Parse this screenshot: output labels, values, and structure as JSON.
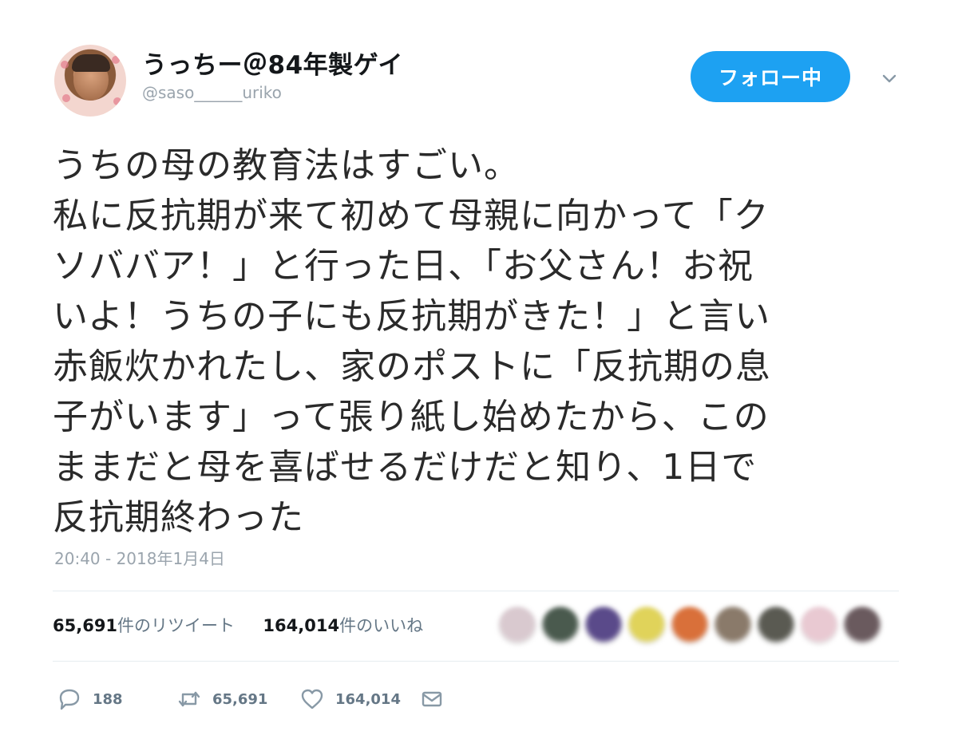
{
  "user": {
    "display_name": "うっちー＠84年製ゲイ",
    "handle": "@saso______uriko"
  },
  "follow_button": {
    "label": "フォロー中"
  },
  "tweet": {
    "lines": [
      "うちの母の教育法はすごい。",
      "私に反抗期が来て初めて母親に向かって「ク",
      "ソババア！」と行った日、「お父さん！お祝",
      "いよ！うちの子にも反抗期がきた！」と言い",
      "赤飯炊かれたし、家のポストに「反抗期の息",
      "子がいます」って張り紙し始めたから、この",
      "ままだと母を喜ばせるだけだと知り、1日で",
      "反抗期終わった"
    ],
    "timestamp": "20:40 - 2018年1月4日"
  },
  "stats": {
    "retweets_count": "65,691",
    "retweets_label": "件のリツイート",
    "likes_count": "164,014",
    "likes_label": "件のいいね"
  },
  "liker_colors": [
    "#d9c9cf",
    "#4a5a4e",
    "#5a4a8a",
    "#e0d35a",
    "#d9703a",
    "#8a7a6a",
    "#5a5a52",
    "#e9c9d2",
    "#6a5a5e"
  ],
  "actions": {
    "reply_count": "188",
    "retweet_count": "65,691",
    "like_count": "164,014"
  },
  "colors": {
    "accent": "#1da1f2",
    "muted": "#9aa4ad"
  }
}
